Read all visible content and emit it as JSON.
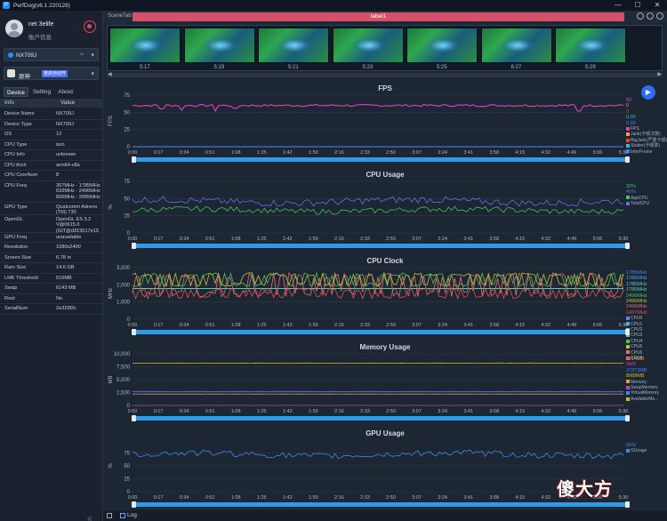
{
  "window": {
    "title": "PerfDog(v6.1.220128)",
    "controls": [
      "—",
      "☐",
      "✕"
    ]
  },
  "user": {
    "name": "net 3elife",
    "account": "账户信息"
  },
  "device": {
    "name": "NX709J"
  },
  "app": {
    "name": "原神",
    "tag": "重启自动开"
  },
  "tabs": [
    "Device",
    "Setting",
    "About"
  ],
  "info_header": {
    "key": "Info",
    "value": "Value"
  },
  "info_rows": [
    {
      "k": "Device Name",
      "v": "NX709J"
    },
    {
      "k": "Device Type",
      "v": "NX709J"
    },
    {
      "k": "OS",
      "v": "12"
    },
    {
      "k": "CPU Type",
      "v": "taro"
    },
    {
      "k": "CPU Info",
      "v": "unknown"
    },
    {
      "k": "CPU Arch",
      "v": "arm64-v8a"
    },
    {
      "k": "CPU CoreNum",
      "v": "8"
    },
    {
      "k": "CPU Freq",
      "v": "307MHz - 1785MHz 633MHz - 2496MHz 806MHz - 2995MHz"
    },
    {
      "k": "GPU Type",
      "v": "Qualcomm Adreno (TM) 730"
    },
    {
      "k": "OpenGL",
      "v": "OpenGL ES 3.2 V@0615.0 (GIT@d319517e15"
    },
    {
      "k": "GPU Freq",
      "v": "unavailable"
    },
    {
      "k": "Resolution",
      "v": "1080x2400"
    },
    {
      "k": "Screen Size",
      "v": "6.78 in"
    },
    {
      "k": "Ram Size",
      "v": "14.6 GB"
    },
    {
      "k": "LMK Threshold",
      "v": "516MB"
    },
    {
      "k": "Swap",
      "v": "6143 MB"
    },
    {
      "k": "Root",
      "v": "No"
    },
    {
      "k": "SerialNum",
      "v": "2e329f2c"
    }
  ],
  "scene": {
    "tab_label": "SceneTab",
    "label": "label1"
  },
  "thumbnails": [
    "5:17",
    "5:19",
    "5:21",
    "5:23",
    "5:25",
    "6:27",
    "5:29"
  ],
  "time_ticks": [
    "0:00",
    "0:17",
    "0:34",
    "0:51",
    "1:08",
    "1:25",
    "1:42",
    "1:59",
    "2:16",
    "2:33",
    "2:50",
    "3:07",
    "3:24",
    "3:41",
    "3:58",
    "4:15",
    "4:32",
    "4:49",
    "5:06",
    "5:30"
  ],
  "bottom": {
    "log_label": "Log"
  },
  "watermark": "傻大方",
  "colors": {
    "accent": "#2e6cf5",
    "label_bar": "#d5506b",
    "fps": "#e040c0",
    "cpu_app": "#45c25a",
    "cpu_total": "#6e6be8",
    "clk_red": "#e07070",
    "clk_teal": "#5ad0c8"
  },
  "chart_data": [
    {
      "id": "fps",
      "type": "line",
      "title": "FPS",
      "ylabel": "FPS",
      "yticks": [
        "0",
        "25",
        "50",
        "75"
      ],
      "ylim": [
        0,
        75
      ],
      "series": [
        {
          "name": "FPS",
          "color": "#e040c0",
          "value_label": "60",
          "base": 60,
          "noise": 1.5,
          "dips": [
            [
              0.06,
              55
            ],
            [
              0.1,
              53
            ],
            [
              0.17,
              52
            ],
            [
              0.21,
              56
            ],
            [
              0.91,
              52
            ]
          ]
        },
        {
          "name": "Jank(卡顿次数)",
          "color": "#f0a040",
          "value_label": "0",
          "base": 0,
          "noise": 0
        },
        {
          "name": "BigJank(严重卡顿)",
          "color": "#e04040",
          "value_label": "0",
          "base": 0,
          "noise": 0
        },
        {
          "name": "Stutter(卡顿率)",
          "color": "#4ab0e0",
          "value_label": "0.00",
          "base": 0,
          "noise": 0
        },
        {
          "name": "InterFrame",
          "color": "#4a80ff",
          "value_label": "0.00",
          "base": 0,
          "noise": 0
        }
      ]
    },
    {
      "id": "cpu",
      "type": "line",
      "title": "CPU Usage",
      "ylabel": "%",
      "yticks": [
        "0",
        "25",
        "50",
        "75"
      ],
      "ylim": [
        0,
        75
      ],
      "series": [
        {
          "name": "AppCPU",
          "color": "#45c25a",
          "value_label": "32%",
          "base": 33,
          "noise": 4
        },
        {
          "name": "TotalCPU",
          "color": "#6e6be8",
          "value_label": "45%",
          "base": 46,
          "noise": 5
        }
      ]
    },
    {
      "id": "clock",
      "type": "line",
      "title": "CPU Clock",
      "ylabel": "MHz",
      "yticks": [
        "0",
        "1,000",
        "2,000",
        "3,000"
      ],
      "ylim": [
        0,
        3000
      ],
      "series": [
        {
          "name": "CPU0",
          "color": "#6a78ff",
          "value_label": "1785MHz",
          "base": 1785,
          "noise": 0
        },
        {
          "name": "CPU1",
          "color": "#4ab0e0",
          "value_label": "1785MHz",
          "base": 1785,
          "noise": 0
        },
        {
          "name": "CPU2",
          "color": "#5ad0c8",
          "value_label": "1785MHz",
          "base": 1785,
          "noise": 0
        },
        {
          "name": "CPU3",
          "color": "#5ad0a8",
          "value_label": "1785MHz",
          "base": 1785,
          "noise": 0
        },
        {
          "name": "CPU4",
          "color": "#45c25a",
          "value_label": "2496MHz",
          "base": 2300,
          "noise": 400,
          "square": true
        },
        {
          "name": "CPU5",
          "color": "#c0c040",
          "value_label": "2496MHz",
          "base": 2300,
          "noise": 400,
          "square": true
        },
        {
          "name": "CPU6",
          "color": "#e07070",
          "value_label": "2496MHz",
          "base": 2000,
          "noise": 700,
          "square": true
        },
        {
          "name": "CPU7",
          "color": "#e05050",
          "value_label": "1497MHz",
          "base": 1500,
          "noise": 300,
          "square": true
        }
      ]
    },
    {
      "id": "memory",
      "type": "line",
      "title": "Memory Usage",
      "ylabel": "MB",
      "yticks": [
        "0",
        "2,500",
        "5,000",
        "7,500",
        "10,000"
      ],
      "ylim": [
        0,
        10000
      ],
      "series": [
        {
          "name": "Memory",
          "color": "#e0a040",
          "value_label": "2214MB",
          "base": 2214,
          "noise": 10
        },
        {
          "name": "SwapMemory",
          "color": "#c040c0",
          "value_label": "0MB",
          "base": 0,
          "noise": 0
        },
        {
          "name": "VirtualMemory",
          "color": "#4a80ff",
          "value_label": "27373MB",
          "base": 2700,
          "noise": 10
        },
        {
          "name": "AvailableMe...",
          "color": "#c8c020",
          "value_label": "8089MB",
          "base": 8200,
          "noise": 30
        }
      ]
    },
    {
      "id": "gpu",
      "type": "line",
      "title": "GPU Usage",
      "ylabel": "%",
      "yticks": [
        "0",
        "25",
        "50",
        "75"
      ],
      "ylim": [
        0,
        100
      ],
      "series": [
        {
          "name": "GUsage",
          "color": "#3d8ae8",
          "value_label": "65%",
          "base": 72,
          "noise": 6
        }
      ]
    }
  ]
}
